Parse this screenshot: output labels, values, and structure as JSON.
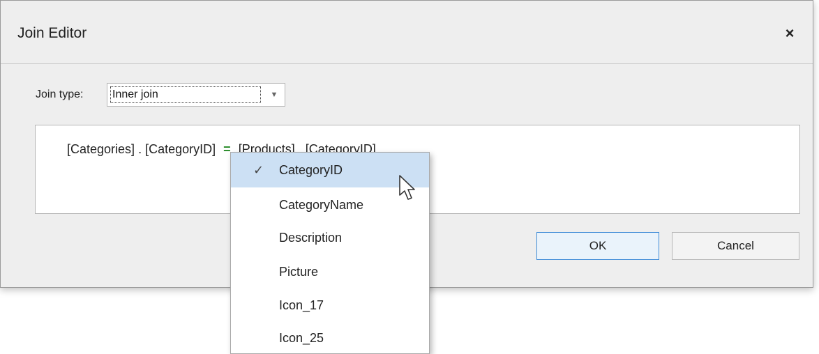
{
  "dialog": {
    "title": "Join Editor",
    "close_icon": "×"
  },
  "join_type": {
    "label": "Join type:",
    "value": "Inner join",
    "arrow_icon": "▼"
  },
  "expression": {
    "left_table": "[Categories]",
    "dot": ".",
    "left_column": "[CategoryID]",
    "operator": "=",
    "right_table": "[Products]",
    "right_column": "[CategoryID]"
  },
  "buttons": {
    "ok": "OK",
    "cancel": "Cancel"
  },
  "column_dropdown": {
    "checkmark": "✓",
    "items": [
      {
        "label": "CategoryID",
        "selected": true
      },
      {
        "label": "CategoryName",
        "selected": false
      },
      {
        "label": "Description",
        "selected": false
      },
      {
        "label": "Picture",
        "selected": false
      },
      {
        "label": "Icon_17",
        "selected": false
      },
      {
        "label": "Icon_25",
        "selected": false
      }
    ]
  },
  "colors": {
    "selection": "#cce0f4",
    "operator": "#2f8f2f",
    "ok_border": "#3e8bd7"
  }
}
